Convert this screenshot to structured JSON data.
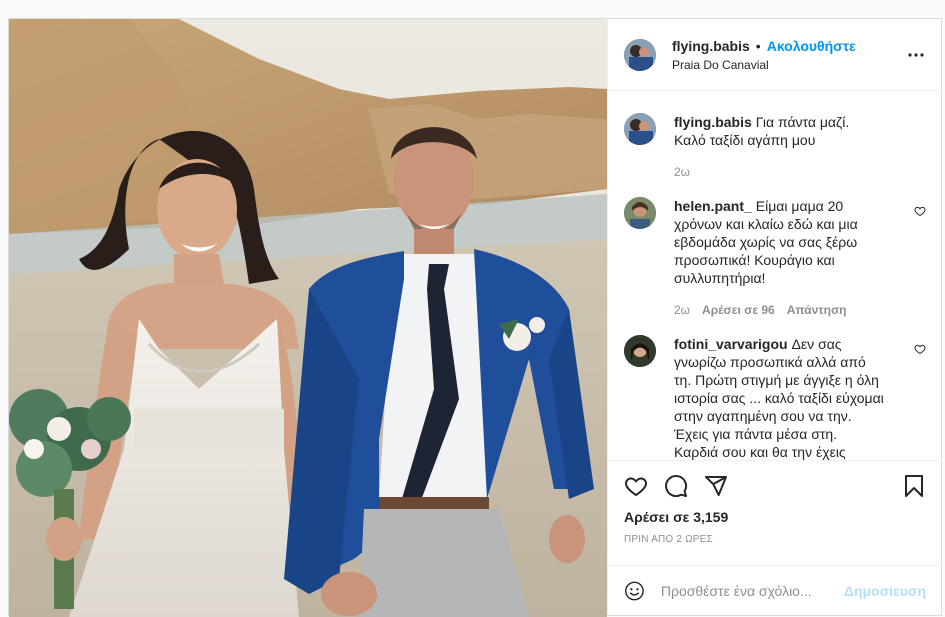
{
  "post": {
    "username": "flying.babis",
    "follow_label": "Ακολουθήστε",
    "separator": "•",
    "location": "Praia Do Canavial",
    "more_icon": "more-horizontal-icon"
  },
  "caption": {
    "username": "flying.babis",
    "text": "Για πάντα μαζί. Καλό ταξίδι αγάπη μου",
    "time": "2ω"
  },
  "comments": [
    {
      "username": "helen.pant_",
      "text": "Είμαι μαμα 20 χρόνων και κλαίω εδώ και μια εβδομάδα χωρίς να σας ξέρω προσωπικά! Κουράγιο και συλλυπητήρια!",
      "time": "2ω",
      "likes_label": "Αρέσει σε 96",
      "reply_label": "Απάντηση"
    },
    {
      "username": "fotini_varvarigou",
      "text": "Δεν σας γνωρίζω προσωπικά αλλά από τη. Πρώτη στιγμή με άγγιξε η όλη ιστορία σας ... καλό ταξίδι εύχομαι στην αγαπημένη σου να την. Έχεις για πάντα μέσα στη. Καρδιά σου και θα την έχεις"
    }
  ],
  "actions": {
    "likes": "Αρέσει σε 3,159",
    "time": "ΠΡΙΝ ΑΠΟ 2 ΩΡΕΣ"
  },
  "add_comment": {
    "placeholder": "Προσθέστε ένα σχόλιο...",
    "post_label": "Δημοσίευση"
  },
  "colors": {
    "accent": "#0095f6",
    "post_disabled": "#b2dffc",
    "muted": "#8e8e8e"
  }
}
